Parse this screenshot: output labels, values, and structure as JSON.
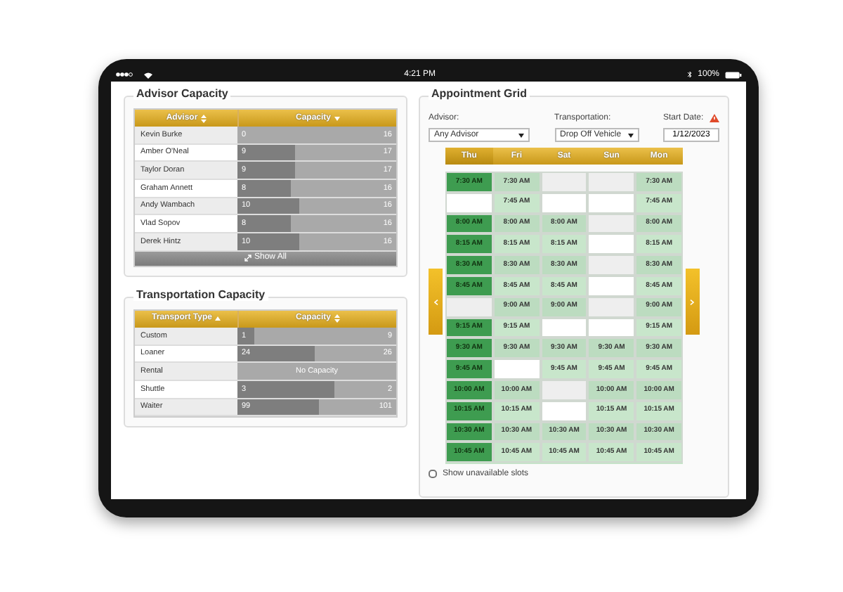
{
  "status_bar": {
    "time": "4:21 PM",
    "battery": "100%"
  },
  "advisor_capacity": {
    "title": "Advisor Capacity",
    "columns": [
      {
        "label": "Advisor",
        "sorted": false
      },
      {
        "label": "Capacity",
        "sorted": true,
        "descending": true
      }
    ],
    "rows": [
      {
        "name": "Kevin Burke",
        "value": "0",
        "max": "16",
        "level": 0
      },
      {
        "name": "Amber O'Neal",
        "value": "9",
        "max": "17",
        "level": 0.36
      },
      {
        "name": "Taylor Doran",
        "value": "9",
        "max": "17",
        "level": 0.36
      },
      {
        "name": "Graham Annett",
        "value": "8",
        "max": "16",
        "level": 0.34
      },
      {
        "name": "Andy Wambach",
        "value": "10",
        "max": "16",
        "level": 0.39
      },
      {
        "name": "Vlad Sopov",
        "value": "8",
        "max": "16",
        "level": 0.34
      },
      {
        "name": "Derek Hintz",
        "value": "10",
        "max": "16",
        "level": 0.39
      }
    ],
    "show_all": "Show All"
  },
  "transportation_capacity": {
    "title": "Transportation Capacity",
    "columns": [
      {
        "label": "Transport Type",
        "sorted": true,
        "descending": false
      },
      {
        "label": "Capacity",
        "sorted": false
      }
    ],
    "rows": [
      {
        "name": "Custom",
        "kind": "bar",
        "value": "1",
        "max": "9",
        "level": 0.11
      },
      {
        "name": "Loaner",
        "kind": "bar",
        "value": "24",
        "max": "26",
        "level": 0.49
      },
      {
        "name": "Rental",
        "kind": "note",
        "note": "No Capacity"
      },
      {
        "name": "Shuttle",
        "kind": "bar",
        "value": "3",
        "max": "2",
        "level": 0.61
      },
      {
        "name": "Waiter",
        "kind": "bar",
        "value": "99",
        "max": "101",
        "level": 0.51
      }
    ]
  },
  "appointment_grid": {
    "title": "Appointment Grid",
    "advisor": {
      "label": "Advisor:",
      "value": "Any Advisor"
    },
    "transportation": {
      "label": "Transportation:",
      "value": "Drop Off Vehicle"
    },
    "start_date": {
      "label": "Start Date:",
      "value": "1/12/2023",
      "warning": true
    },
    "days": [
      {
        "label": "Thu",
        "selected": true
      },
      {
        "label": "Fri",
        "selected": false
      },
      {
        "label": "Sat",
        "selected": false
      },
      {
        "label": "Sun",
        "selected": false
      },
      {
        "label": "Mon",
        "selected": false
      }
    ],
    "rows": [
      [
        "7:30 AM",
        "7:30 AM",
        null,
        null,
        "7:30 AM"
      ],
      [
        null,
        "7:45 AM",
        null,
        null,
        "7:45 AM"
      ],
      [
        "8:00 AM",
        "8:00 AM",
        "8:00 AM",
        null,
        "8:00 AM"
      ],
      [
        "8:15 AM",
        "8:15 AM",
        "8:15 AM",
        null,
        "8:15 AM"
      ],
      [
        "8:30 AM",
        "8:30 AM",
        "8:30 AM",
        null,
        "8:30 AM"
      ],
      [
        "8:45 AM",
        "8:45 AM",
        "8:45 AM",
        null,
        "8:45 AM"
      ],
      [
        null,
        "9:00 AM",
        "9:00 AM",
        null,
        "9:00 AM"
      ],
      [
        "9:15 AM",
        "9:15 AM",
        null,
        null,
        "9:15 AM"
      ],
      [
        "9:30 AM",
        "9:30 AM",
        "9:30 AM",
        "9:30 AM",
        "9:30 AM"
      ],
      [
        "9:45 AM",
        null,
        "9:45 AM",
        "9:45 AM",
        "9:45 AM"
      ],
      [
        "10:00 AM",
        "10:00 AM",
        null,
        "10:00 AM",
        "10:00 AM"
      ],
      [
        "10:15 AM",
        "10:15 AM",
        null,
        "10:15 AM",
        "10:15 AM"
      ],
      [
        "10:30 AM",
        "10:30 AM",
        "10:30 AM",
        "10:30 AM",
        "10:30 AM"
      ],
      [
        "10:45 AM",
        "10:45 AM",
        "10:45 AM",
        "10:45 AM",
        "10:45 AM"
      ]
    ],
    "show_unavailable": {
      "label": "Show unavailable slots",
      "checked": false
    }
  }
}
